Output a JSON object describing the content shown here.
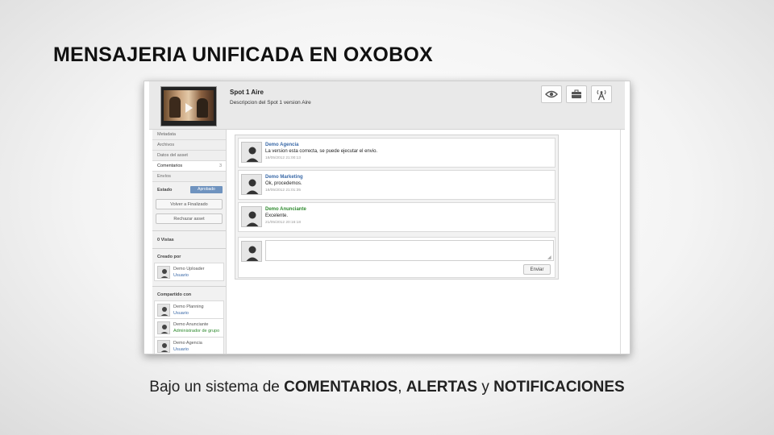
{
  "slide": {
    "title": "MENSAJERIA UNIFICADA EN OXOBOX",
    "caption_prefix": "Bajo un sistema de ",
    "caption_k1": "COMENTARIOS",
    "caption_sep": ", ",
    "caption_k2": "ALERTAS",
    "caption_mid": " y ",
    "caption_k3": "NOTIFICACIONES"
  },
  "asset": {
    "title": "Spot 1 Aire",
    "description": "Descripcion del Spot 1 version Aire"
  },
  "toolbar": {
    "icons": [
      "eye-icon",
      "briefcase-icon",
      "broadcast-icon"
    ]
  },
  "sidebar": {
    "items": [
      {
        "label": "Metadata"
      },
      {
        "label": "Archivos"
      },
      {
        "label": "Datos del asset"
      },
      {
        "label": "Comentarios",
        "count": "3"
      },
      {
        "label": "Envíos"
      }
    ],
    "estado_label": "Estado",
    "estado_value": "Aprobado",
    "btn_finalizado": "Volver a Finalizado",
    "btn_rechazar": "Rechazar asset",
    "views": "0 Vistas",
    "created_by_label": "Creado por",
    "creator": {
      "name": "Demo Uploader",
      "role": "Usuario"
    },
    "shared_label": "Compartido con",
    "shared": [
      {
        "name": "Demo Planning",
        "role": "Usuario"
      },
      {
        "name": "Demo Anunciante",
        "role": "Administrador de grupo"
      },
      {
        "name": "Demo Agencia",
        "role": "Usuario"
      }
    ]
  },
  "comments": [
    {
      "author": "Demo Agencia",
      "text": "La version esta correcta, se puede ejecutar el envio.",
      "date": "18/05/2012 21:00:13"
    },
    {
      "author": "Demo Marketing",
      "text": "Ok, procedemos.",
      "date": "18/05/2012 21:01:35"
    },
    {
      "author": "Demo Anunciante",
      "text": "Excelente.",
      "date": "21/05/2012 20:16:18"
    }
  ],
  "reply": {
    "send_label": "Enviar"
  },
  "colors": {
    "link_blue": "#3b6aa8",
    "group_green": "#2f8a2f",
    "badge_blue": "#6f93bf"
  }
}
